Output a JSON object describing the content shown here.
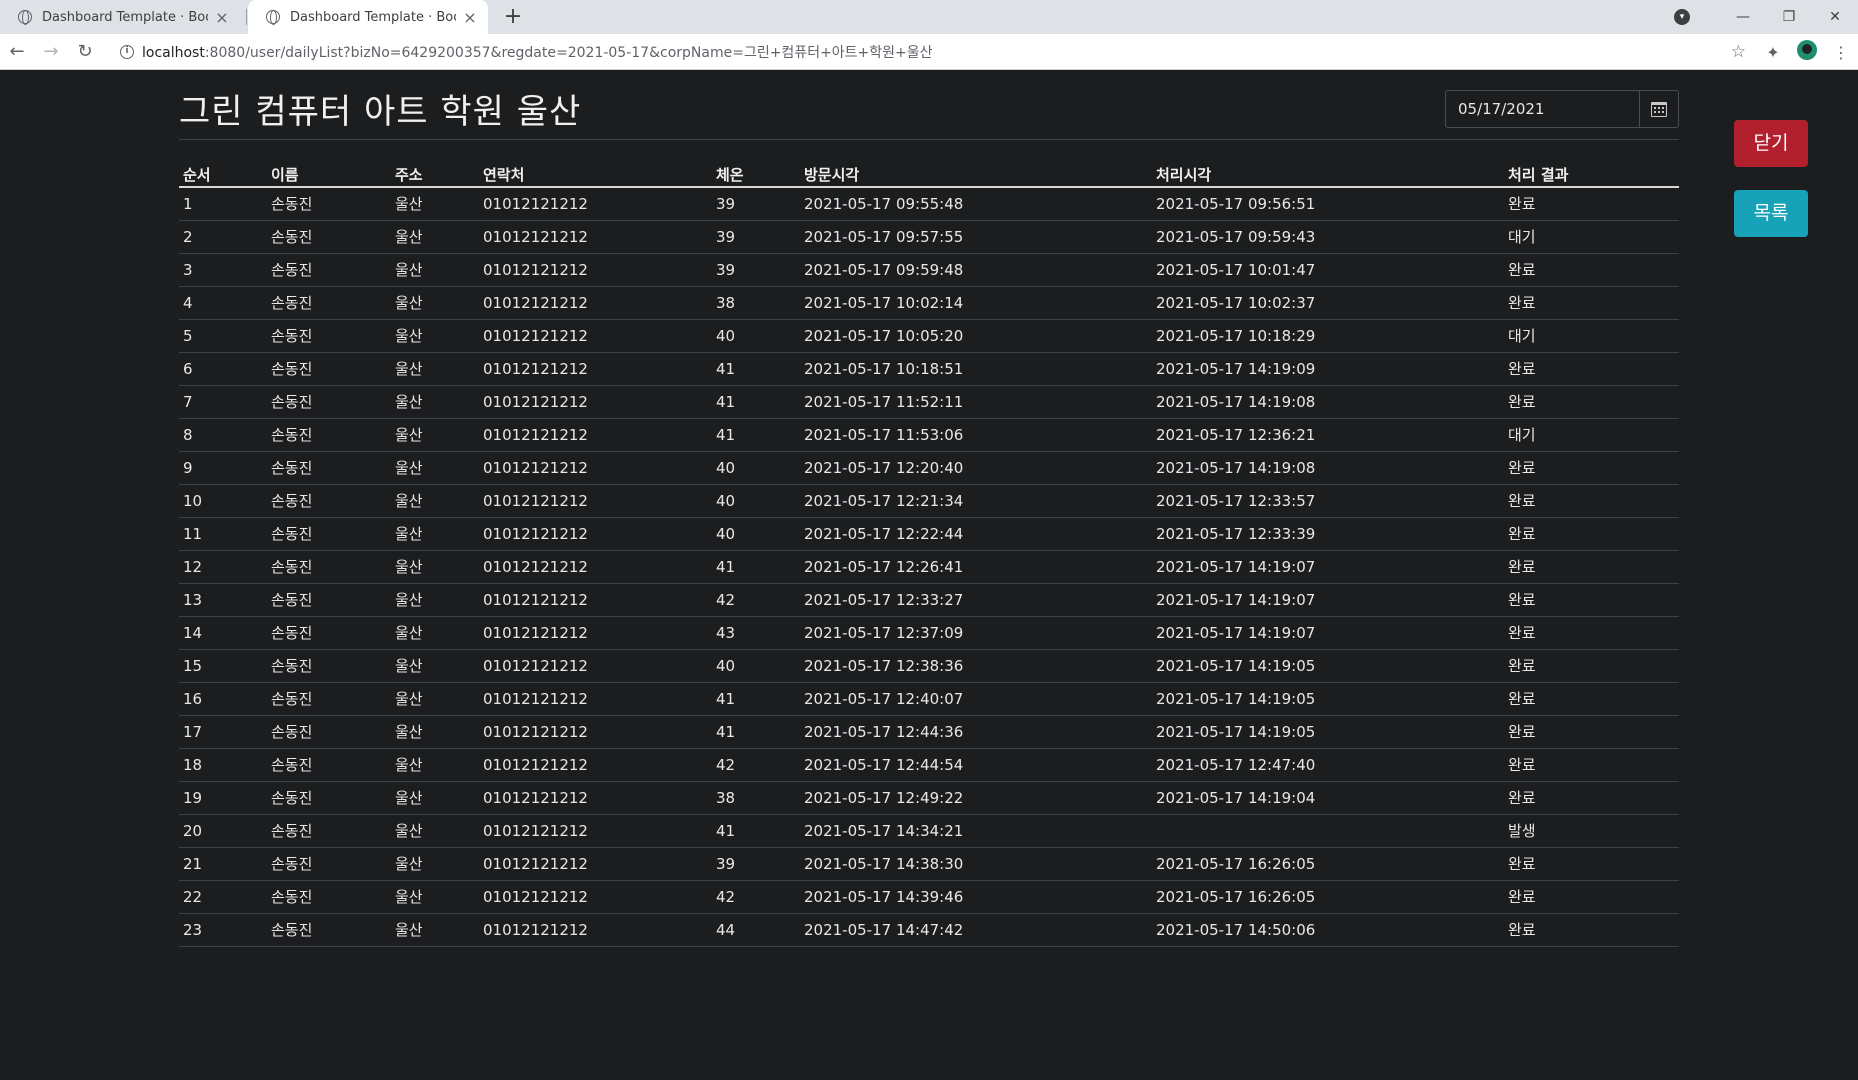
{
  "browser": {
    "tabs": [
      {
        "title": "Dashboard Template · Bootstrap",
        "active": false
      },
      {
        "title": "Dashboard Template · Bootstrap",
        "active": true
      }
    ],
    "url_host": "localhost",
    "url_rest": ":8080/user/dailyList?bizNo=6429200357&regdate=2021-05-17&corpName=그린+컴퓨터+아트+학원+울산"
  },
  "page": {
    "title": "그린 컴퓨터 아트 학원 울산",
    "date_value": "05/17/2021",
    "close_label": "닫기",
    "list_label": "목록"
  },
  "table": {
    "headers": [
      "순서",
      "이름",
      "주소",
      "연락처",
      "체온",
      "방문시각",
      "처리시각",
      "처리 결과"
    ],
    "rows": [
      [
        "1",
        "손동진",
        "울산",
        "01012121212",
        "39",
        "2021-05-17 09:55:48",
        "2021-05-17 09:56:51",
        "완료"
      ],
      [
        "2",
        "손동진",
        "울산",
        "01012121212",
        "39",
        "2021-05-17 09:57:55",
        "2021-05-17 09:59:43",
        "대기"
      ],
      [
        "3",
        "손동진",
        "울산",
        "01012121212",
        "39",
        "2021-05-17 09:59:48",
        "2021-05-17 10:01:47",
        "완료"
      ],
      [
        "4",
        "손동진",
        "울산",
        "01012121212",
        "38",
        "2021-05-17 10:02:14",
        "2021-05-17 10:02:37",
        "완료"
      ],
      [
        "5",
        "손동진",
        "울산",
        "01012121212",
        "40",
        "2021-05-17 10:05:20",
        "2021-05-17 10:18:29",
        "대기"
      ],
      [
        "6",
        "손동진",
        "울산",
        "01012121212",
        "41",
        "2021-05-17 10:18:51",
        "2021-05-17 14:19:09",
        "완료"
      ],
      [
        "7",
        "손동진",
        "울산",
        "01012121212",
        "41",
        "2021-05-17 11:52:11",
        "2021-05-17 14:19:08",
        "완료"
      ],
      [
        "8",
        "손동진",
        "울산",
        "01012121212",
        "41",
        "2021-05-17 11:53:06",
        "2021-05-17 12:36:21",
        "대기"
      ],
      [
        "9",
        "손동진",
        "울산",
        "01012121212",
        "40",
        "2021-05-17 12:20:40",
        "2021-05-17 14:19:08",
        "완료"
      ],
      [
        "10",
        "손동진",
        "울산",
        "01012121212",
        "40",
        "2021-05-17 12:21:34",
        "2021-05-17 12:33:57",
        "완료"
      ],
      [
        "11",
        "손동진",
        "울산",
        "01012121212",
        "40",
        "2021-05-17 12:22:44",
        "2021-05-17 12:33:39",
        "완료"
      ],
      [
        "12",
        "손동진",
        "울산",
        "01012121212",
        "41",
        "2021-05-17 12:26:41",
        "2021-05-17 14:19:07",
        "완료"
      ],
      [
        "13",
        "손동진",
        "울산",
        "01012121212",
        "42",
        "2021-05-17 12:33:27",
        "2021-05-17 14:19:07",
        "완료"
      ],
      [
        "14",
        "손동진",
        "울산",
        "01012121212",
        "43",
        "2021-05-17 12:37:09",
        "2021-05-17 14:19:07",
        "완료"
      ],
      [
        "15",
        "손동진",
        "울산",
        "01012121212",
        "40",
        "2021-05-17 12:38:36",
        "2021-05-17 14:19:05",
        "완료"
      ],
      [
        "16",
        "손동진",
        "울산",
        "01012121212",
        "41",
        "2021-05-17 12:40:07",
        "2021-05-17 14:19:05",
        "완료"
      ],
      [
        "17",
        "손동진",
        "울산",
        "01012121212",
        "41",
        "2021-05-17 12:44:36",
        "2021-05-17 14:19:05",
        "완료"
      ],
      [
        "18",
        "손동진",
        "울산",
        "01012121212",
        "42",
        "2021-05-17 12:44:54",
        "2021-05-17 12:47:40",
        "완료"
      ],
      [
        "19",
        "손동진",
        "울산",
        "01012121212",
        "38",
        "2021-05-17 12:49:22",
        "2021-05-17 14:19:04",
        "완료"
      ],
      [
        "20",
        "손동진",
        "울산",
        "01012121212",
        "41",
        "2021-05-17 14:34:21",
        "",
        "발생"
      ],
      [
        "21",
        "손동진",
        "울산",
        "01012121212",
        "39",
        "2021-05-17 14:38:30",
        "2021-05-17 16:26:05",
        "완료"
      ],
      [
        "22",
        "손동진",
        "울산",
        "01012121212",
        "42",
        "2021-05-17 14:39:46",
        "2021-05-17 16:26:05",
        "완료"
      ],
      [
        "23",
        "손동진",
        "울산",
        "01012121212",
        "44",
        "2021-05-17 14:47:42",
        "2021-05-17 14:50:06",
        "완료"
      ]
    ]
  },
  "colors": {
    "background": "#1b1d1f",
    "close_button": "#b21f2d",
    "list_button": "#17a2b8"
  }
}
